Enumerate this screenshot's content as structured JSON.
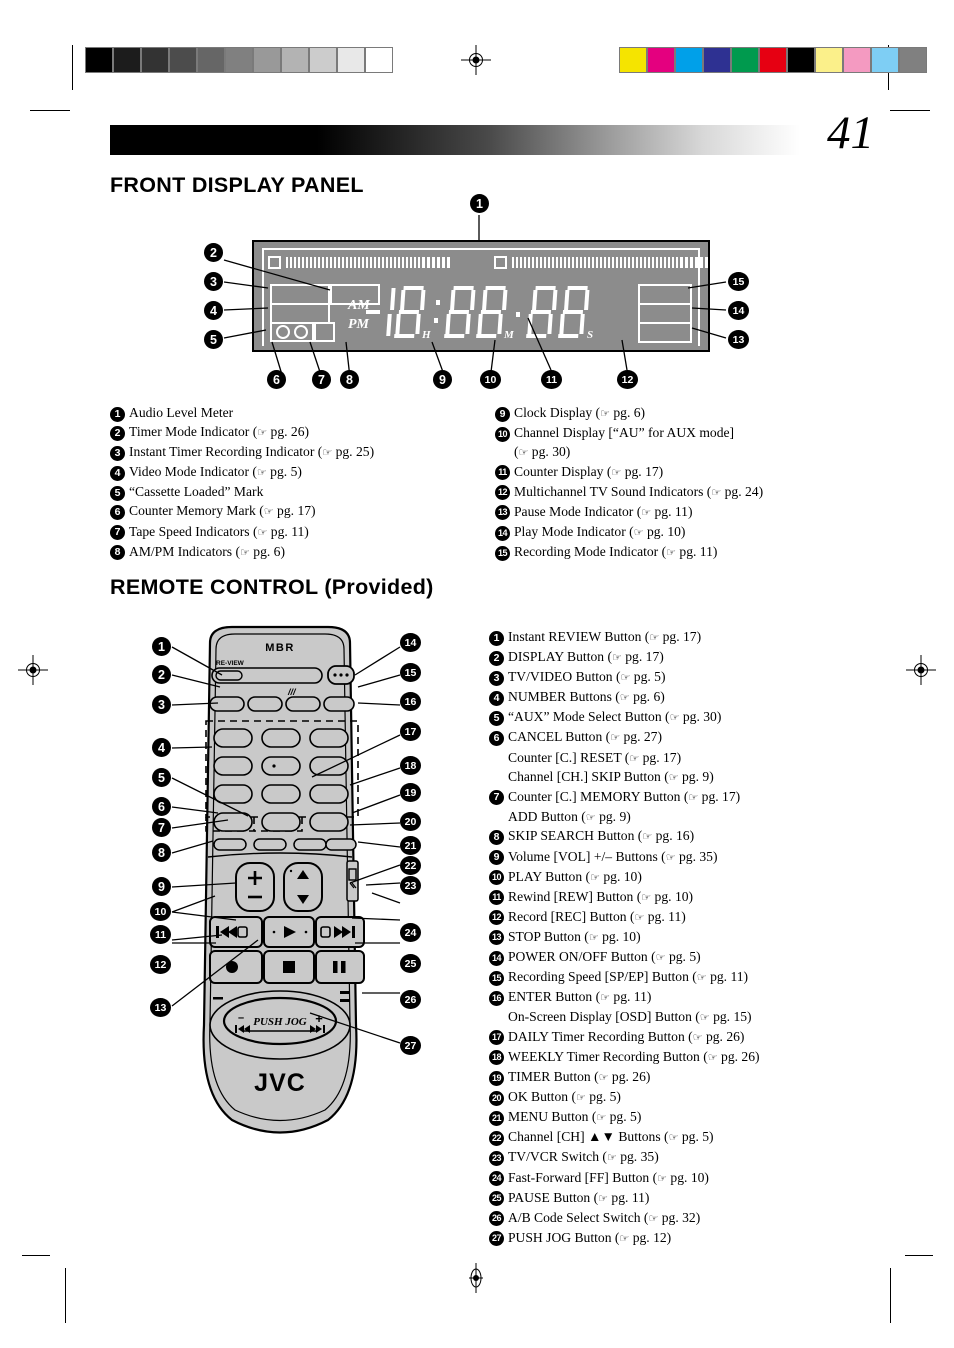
{
  "page": {
    "number": "41"
  },
  "sections": {
    "front_display": {
      "title": "FRONT DISPLAY PANEL",
      "display": {
        "am_label": "AM",
        "pm_label": "PM",
        "h_label": "H",
        "m_label": "M",
        "s_label": "S",
        "digits": "18:88.88"
      },
      "legend_left": [
        {
          "num": "1",
          "text": "Audio Level Meter"
        },
        {
          "num": "2",
          "text": "Timer Mode Indicator (",
          "page": "pg. 26",
          "tail": ")"
        },
        {
          "num": "3",
          "text": "Instant Timer Recording Indicator (",
          "page": "pg. 25",
          "tail": ")"
        },
        {
          "num": "4",
          "text": "Video Mode Indicator (",
          "page": "pg. 5",
          "tail": ")"
        },
        {
          "num": "5",
          "text": "“Cassette Loaded” Mark"
        },
        {
          "num": "6",
          "text": "Counter Memory Mark (",
          "page": "pg. 17",
          "tail": ")"
        },
        {
          "num": "7",
          "text": "Tape Speed Indicators (",
          "page": "pg. 11",
          "tail": ")"
        },
        {
          "num": "8",
          "text": "AM/PM Indicators (",
          "page": "pg. 6",
          "tail": ")"
        }
      ],
      "legend_right": [
        {
          "num": "9",
          "text": "Clock Display (",
          "page": "pg. 6",
          "tail": ")"
        },
        {
          "num": "10",
          "text": "Channel Display [“AU” for AUX mode]",
          "sub_page": "pg. 30",
          "sub_prefix": "(",
          "sub_tail": ")"
        },
        {
          "num": "11",
          "text": "Counter Display (",
          "page": "pg. 17",
          "tail": ")"
        },
        {
          "num": "12",
          "text": "Multichannel TV Sound Indicators (",
          "page": "pg. 24",
          "tail": ")"
        },
        {
          "num": "13",
          "text": "Pause Mode Indicator (",
          "page": "pg. 11",
          "tail": ")"
        },
        {
          "num": "14",
          "text": "Play Mode Indicator (",
          "page": "pg. 10",
          "tail": ")"
        },
        {
          "num": "15",
          "text": "Recording Mode Indicator (",
          "page": "pg. 11",
          "tail": ")"
        }
      ],
      "callouts": [
        "1",
        "2",
        "3",
        "4",
        "5",
        "6",
        "7",
        "8",
        "9",
        "10",
        "11",
        "12",
        "13",
        "14",
        "15"
      ]
    },
    "remote_control": {
      "title": "REMOTE CONTROL (Provided)",
      "brand": "JVC",
      "mbr_label": "MBR",
      "review_label": "RE-VIEW",
      "jog_label": "PUSH JOG",
      "jog_minus": "–",
      "jog_plus": "+",
      "legend": [
        {
          "num": "1",
          "text": "Instant REVIEW Button (",
          "page": "pg. 17",
          "tail": ")"
        },
        {
          "num": "2",
          "text": "DISPLAY Button (",
          "page": "pg. 17",
          "tail": ")"
        },
        {
          "num": "3",
          "text": "TV/VIDEO Button (",
          "page": "pg. 5",
          "tail": ")"
        },
        {
          "num": "4",
          "text": "NUMBER Buttons (",
          "page": "pg. 6",
          "tail": ")"
        },
        {
          "num": "5",
          "text": "“AUX” Mode Select Button (",
          "page": "pg. 30",
          "tail": ")"
        },
        {
          "num": "6",
          "text": "CANCEL Button (",
          "page": "pg. 27",
          "tail": ")",
          "subs": [
            {
              "text": "Counter [C.] RESET (",
              "page": "pg. 17",
              "tail": ")"
            },
            {
              "text": "Channel [CH.] SKIP Button (",
              "page": "pg. 9",
              "tail": ")"
            }
          ]
        },
        {
          "num": "7",
          "text": "Counter [C.] MEMORY Button (",
          "page": "pg. 17",
          "tail": ")",
          "subs": [
            {
              "text": "ADD Button (",
              "page": "pg. 9",
              "tail": ")"
            }
          ]
        },
        {
          "num": "8",
          "text": "SKIP SEARCH Button (",
          "page": "pg. 16",
          "tail": ")"
        },
        {
          "num": "9",
          "text": "Volume [VOL] +/– Buttons (",
          "page": "pg. 35",
          "tail": ")"
        },
        {
          "num": "10",
          "text": "PLAY Button (",
          "page": "pg. 10",
          "tail": ")"
        },
        {
          "num": "11",
          "text": "Rewind [REW] Button (",
          "page": "pg. 10",
          "tail": ")"
        },
        {
          "num": "12",
          "text": "Record [REC] Button (",
          "page": "pg. 11",
          "tail": ")"
        },
        {
          "num": "13",
          "text": "STOP Button (",
          "page": "pg. 10",
          "tail": ")"
        },
        {
          "num": "14",
          "text": "POWER ON/OFF Button (",
          "page": "pg. 5",
          "tail": ")"
        },
        {
          "num": "15",
          "text": "Recording Speed [SP/EP] Button (",
          "page": "pg. 11",
          "tail": ")"
        },
        {
          "num": "16",
          "text": "ENTER Button (",
          "page": "pg. 11",
          "tail": ")",
          "subs": [
            {
              "text": "On-Screen Display [OSD] Button (",
              "page": "pg. 15",
              "tail": ")"
            }
          ]
        },
        {
          "num": "17",
          "text": "DAILY Timer Recording Button (",
          "page": "pg. 26",
          "tail": ")"
        },
        {
          "num": "18",
          "text": "WEEKLY Timer Recording Button (",
          "page": "pg. 26",
          "tail": ")"
        },
        {
          "num": "19",
          "text": "TIMER Button (",
          "page": "pg. 26",
          "tail": ")"
        },
        {
          "num": "20",
          "text": "OK Button (",
          "page": "pg. 5",
          "tail": ")"
        },
        {
          "num": "21",
          "text": "MENU Button (",
          "page": "pg. 5",
          "tail": ")"
        },
        {
          "num": "22",
          "text": "Channel [CH] ▲▼ Buttons (",
          "page": "pg. 5",
          "tail": ")"
        },
        {
          "num": "23",
          "text": "TV/VCR Switch (",
          "page": "pg. 35",
          "tail": ")"
        },
        {
          "num": "24",
          "text": "Fast-Forward [FF] Button (",
          "page": "pg. 10",
          "tail": ")"
        },
        {
          "num": "25",
          "text": "PAUSE Button (",
          "page": "pg. 11",
          "tail": ")"
        },
        {
          "num": "26",
          "text": "A/B Code Select Switch (",
          "page": "pg. 32",
          "tail": ")"
        },
        {
          "num": "27",
          "text": "PUSH JOG Button (",
          "page": "pg. 12",
          "tail": ")"
        }
      ],
      "callouts_left": [
        "1",
        "2",
        "3",
        "4",
        "5",
        "6",
        "7",
        "8",
        "9",
        "10",
        "11",
        "12",
        "13"
      ],
      "callouts_right": [
        "14",
        "15",
        "16",
        "17",
        "18",
        "19",
        "20",
        "21",
        "22",
        "23",
        "24",
        "25",
        "26",
        "27"
      ]
    }
  },
  "print_marks": {
    "grayscale_bar": [
      "#000000",
      "#1c1c1c",
      "#333333",
      "#4c4c4c",
      "#666666",
      "#808080",
      "#999999",
      "#b3b3b3",
      "#cccccc",
      "#e8e8e8",
      "#ffffff"
    ],
    "color_bar": [
      "#f5e400",
      "#e4007f",
      "#00a0e9",
      "#2e3192",
      "#009a4e",
      "#e60012",
      "#000000",
      "#fbf08a",
      "#f49ac1",
      "#7ecef4",
      "#808080"
    ]
  }
}
